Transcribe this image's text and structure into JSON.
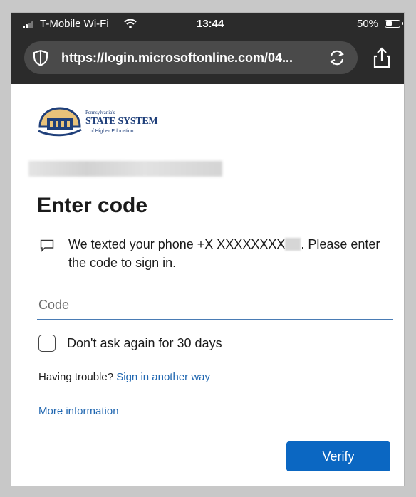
{
  "status_bar": {
    "carrier": "T-Mobile Wi-Fi",
    "time": "13:44",
    "battery": "50%"
  },
  "browser": {
    "url": "https://login.microsoftonline.com/04..."
  },
  "logo": {
    "line1": "Pennsylvania's",
    "line2": "STATE SYSTEM",
    "line3": "of Higher Education"
  },
  "page": {
    "heading": "Enter code",
    "message_prefix": "We texted your phone +X XXXXXXXX",
    "message_suffix": ". Please enter the code to sign in.",
    "code_placeholder": "Code",
    "remember_label": "Don't ask again for 30 days",
    "trouble_text": "Having trouble?",
    "trouble_link": "Sign in another way",
    "more_info": "More information",
    "verify_label": "Verify"
  },
  "colors": {
    "accent": "#0b67c2",
    "link": "#1f66b0",
    "topbar": "#2b2b2b"
  }
}
